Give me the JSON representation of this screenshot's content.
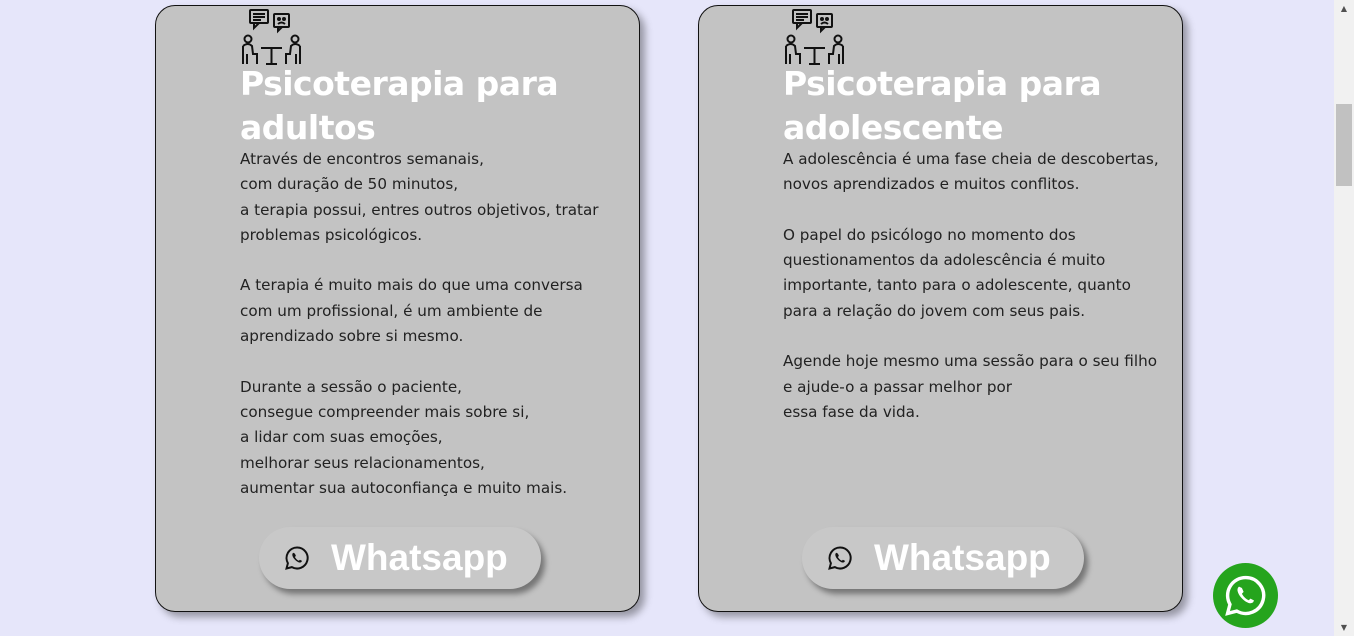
{
  "cards": [
    {
      "title": "Psicoterapia para adultos",
      "body": "Através de encontros semanais,\ncom duração de 50 minutos,\na terapia possui, entres outros objetivos, tratar problemas psicológicos.\n\nA terapia é muito mais do que uma conversa com um profissional, é um ambiente de aprendizado sobre si mesmo.\n\nDurante a sessão o paciente,\nconsegue compreender mais sobre si,\na lidar com suas emoções,\nmelhorar seus relacionamentos,\naumentar sua autoconfiança e muito mais.",
      "button_label": "Whatsapp",
      "icon": "therapy-session-icon"
    },
    {
      "title": "Psicoterapia para adolescente",
      "body": "A adolescência é uma fase cheia de descobertas, novos aprendizados e muitos conflitos.\n\nO papel do psicólogo no momento dos questionamentos da adolescência é muito importante, tanto para o adolescente, quanto para a relação do jovem com seus pais.\n\nAgende hoje mesmo uma sessão para o seu filho e ajude-o a passar melhor por\nessa fase da vida.",
      "button_label": "Whatsapp",
      "icon": "therapy-session-icon"
    }
  ],
  "floating_button": {
    "icon": "whatsapp-icon",
    "color": "#25a41d"
  },
  "colors": {
    "page_background": "#e6e6fa",
    "card_background": "#c3c3c3",
    "title_color": "#ffffff"
  }
}
